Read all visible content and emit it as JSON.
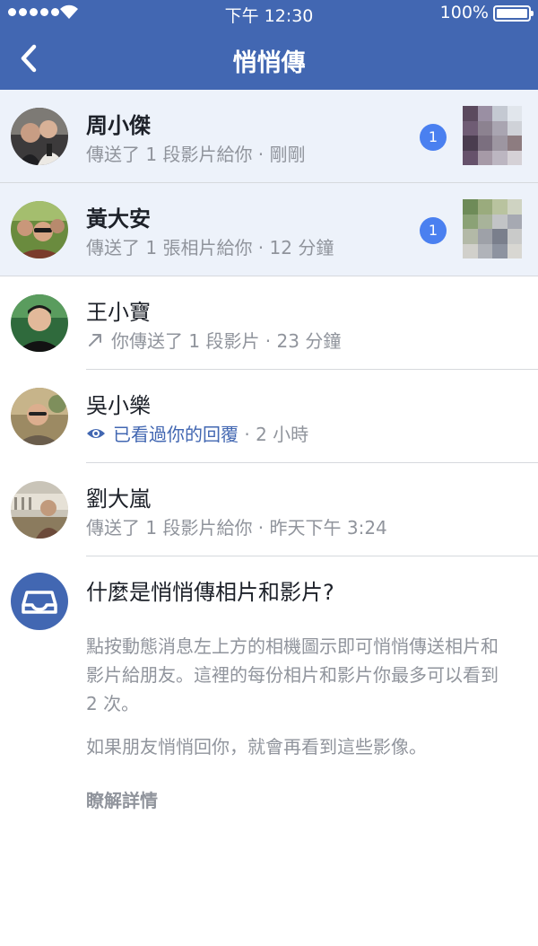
{
  "status_bar": {
    "time": "下午 12:30",
    "battery": "100%"
  },
  "nav": {
    "title": "悄悄傳",
    "back_icon": "chevron-left-icon"
  },
  "conversations": [
    {
      "name": "周小傑",
      "status": "傳送了 1 段影片給你 · 剛剛",
      "unread": true,
      "badge": "1",
      "thumbnail_colors": [
        "#5b4a5e",
        "#9a8fa3",
        "#c4c9d2",
        "#e1e6ec",
        "#6f5c74",
        "#8c8290",
        "#a9a5b1",
        "#cfd2d8",
        "#4a3d4f",
        "#7b6f7f",
        "#9d96a1",
        "#8d7c80",
        "#66526b",
        "#a69aa7",
        "#bcb6c1",
        "#d5d1d6"
      ]
    },
    {
      "name": "黃大安",
      "status": "傳送了 1 張相片給你 · 12 分鐘",
      "unread": true,
      "badge": "1",
      "thumbnail_colors": [
        "#6e8b58",
        "#9aab7d",
        "#b9c39f",
        "#cfd3c2",
        "#8ba276",
        "#a8b39a",
        "#c2c4c6",
        "#a6a9b2",
        "#b3b9a7",
        "#9ea1a8",
        "#7a7f8c",
        "#c9cac9",
        "#d1d0cb",
        "#b0b3b9",
        "#8d93a0",
        "#d8d7d2"
      ]
    },
    {
      "name": "王小寶",
      "status": "你傳送了 1 段影片 · 23 分鐘",
      "unread": false,
      "icon": "sent-arrow-icon"
    },
    {
      "name": "吳小樂",
      "status_seen": "已看過你的回覆",
      "status_time": " · 2 小時",
      "unread": false,
      "icon": "eye-icon"
    },
    {
      "name": "劉大嵐",
      "status": "傳送了 1 段影片給你 · 昨天下午 3:24",
      "unread": false
    }
  ],
  "info": {
    "icon": "inbox-icon",
    "title": "什麼是悄悄傳相片和影片?",
    "paragraph1": "點按動態消息左上方的相機圖示即可悄悄傳送相片和影片給朋友。這裡的每份相片和影片你最多可以看到 2 次。",
    "paragraph2": "如果朋友悄悄回你，就會再看到這些影像。",
    "learn_more": "瞭解詳情"
  },
  "colors": {
    "header": "#4267b2",
    "badge": "#4a80f0",
    "unread_row": "#edf2fa",
    "secondary_text": "#90949c"
  }
}
